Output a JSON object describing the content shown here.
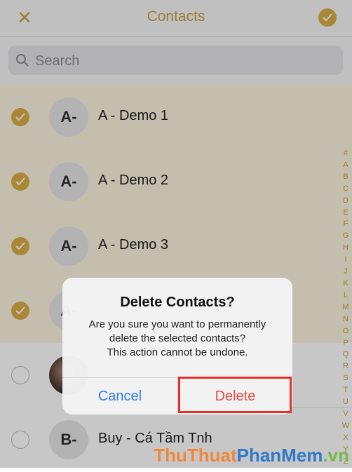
{
  "nav": {
    "close_glyph": "✕",
    "title": "Contacts"
  },
  "search": {
    "placeholder": "Search"
  },
  "contacts": [
    {
      "initials": "A-",
      "name": "A - Demo 1",
      "selected": true
    },
    {
      "initials": "A-",
      "name": "A - Demo 2",
      "selected": true
    },
    {
      "initials": "A-",
      "name": "A - Demo 3",
      "selected": true
    },
    {
      "initials": "A-",
      "name": "",
      "selected": true
    },
    {
      "initials": "",
      "name": "",
      "selected": false,
      "photo": true
    },
    {
      "initials": "B-",
      "name": "Buy - Cá Tầm Tnh",
      "selected": false
    }
  ],
  "index_letters": [
    "#",
    "A",
    "B",
    "C",
    "D",
    "E",
    "F",
    "G",
    "H",
    "I",
    "J",
    "K",
    "L",
    "M",
    "N",
    "O",
    "P",
    "Q",
    "R",
    "S",
    "T",
    "U",
    "V",
    "W",
    "X",
    "Y",
    "Z"
  ],
  "dialog": {
    "title": "Delete Contacts?",
    "message_line1": "Are you sure you want to permanently",
    "message_line2": "delete the selected contacts?",
    "message_line3": "This action cannot be undone.",
    "cancel_label": "Cancel",
    "delete_label": "Delete"
  },
  "watermark": {
    "part1": "ThuThuat",
    "part2": "PhanMem",
    "part3": ".vn"
  },
  "colors": {
    "accent": "#c9a046",
    "selected_bg": "#fbf4df",
    "cancel": "#2d7cf6",
    "delete": "#e9483f",
    "highlight": "#e3322b"
  }
}
